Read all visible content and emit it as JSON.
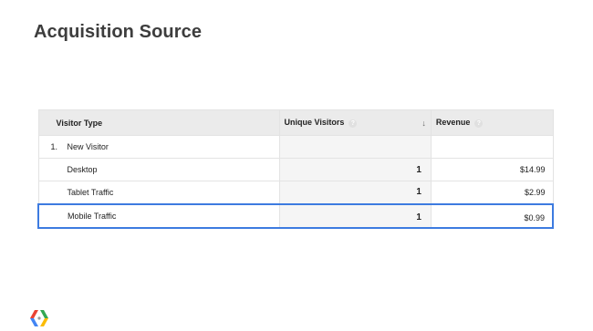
{
  "title": "Acquisition Source",
  "table": {
    "headers": {
      "visitor_type": "Visitor Type",
      "unique_visitors": "Unique Visitors",
      "revenue": "Revenue",
      "help_glyph": "?",
      "sort_glyph": "↓"
    },
    "group": {
      "index": "1.",
      "label": "New Visitor"
    },
    "rows": [
      {
        "type": "Desktop",
        "visitors": "1",
        "revenue": "$14.99",
        "highlighted": false
      },
      {
        "type": "Tablet Traffic",
        "visitors": "1",
        "revenue": "$2.99",
        "highlighted": false
      },
      {
        "type": "Mobile Traffic",
        "visitors": "1",
        "revenue": "$0.99",
        "highlighted": true
      }
    ]
  },
  "colors": {
    "highlight_border": "#3d7be0",
    "header_bg": "#ebebeb",
    "title_text": "#3d3d3d"
  },
  "logo_icon": "google-developers-logo-icon"
}
